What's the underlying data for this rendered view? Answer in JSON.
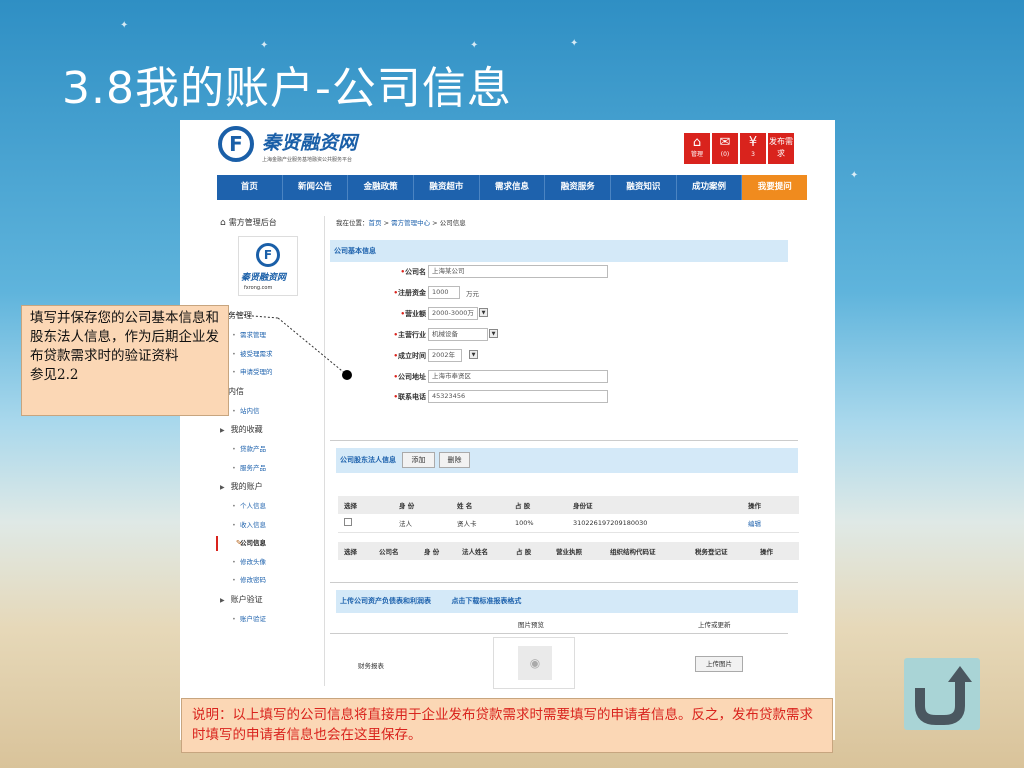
{
  "slide": {
    "title": "3.8我的账户-公司信息"
  },
  "site": {
    "logo_letter": "F",
    "logo_name": "秦贤融资网",
    "logo_tagline": "上海金融产业服务基地融资公共服务平台",
    "top_buttons": [
      {
        "icon": "home-icon",
        "label": "管理",
        "sub": ""
      },
      {
        "icon": "mail-icon",
        "label": "(0)",
        "sub": ""
      },
      {
        "icon": "yen-icon",
        "label": "3",
        "sub": ""
      }
    ],
    "publish_button": "发布需求",
    "nav": [
      "首页",
      "新闻公告",
      "金融政策",
      "融资超市",
      "需求信息",
      "融资服务",
      "融资知识",
      "成功案例",
      "我要提问"
    ]
  },
  "sidebar": {
    "heading": "需方管理后台",
    "logo_letter": "F",
    "logo_name": "秦贤融资网",
    "logo_url": "fxrong.com",
    "sections": [
      {
        "title": "业务管理",
        "items": [
          "需求管理",
          "被受理需求",
          "申请受理的"
        ]
      },
      {
        "title": "站内信",
        "items": [
          "站内信"
        ]
      },
      {
        "title": "我的收藏",
        "items": [
          "贷款产品",
          "服务产品"
        ]
      },
      {
        "title": "我的账户",
        "items": [
          "个人信息",
          "收入信息",
          "公司信息",
          "修改头像",
          "修改密码"
        ]
      },
      {
        "title": "账户验证",
        "items": [
          "账户验证"
        ]
      }
    ],
    "current_item": "公司信息"
  },
  "breadcrumb": {
    "prefix": "我在位置：",
    "home": "首页",
    "sep1": " > ",
    "center": "需方管理中心",
    "sep2": " > ",
    "current": "公司信息"
  },
  "company_form": {
    "section_title": "公司基本信息",
    "fields": [
      {
        "label": "公司名",
        "value": ""
      },
      {
        "label": "注册资金",
        "value": "1000",
        "suffix": "万元"
      },
      {
        "label": "营业额",
        "value": "2000-3000万"
      },
      {
        "label": "主营行业",
        "value": "机械设备"
      },
      {
        "label": "成立时间",
        "value": "2002年"
      },
      {
        "label": "公司地址",
        "value": "上海市奉贤区"
      },
      {
        "label": "联系电话",
        "value": "45323456"
      }
    ],
    "company_name_value": "上海某公司"
  },
  "shareholder": {
    "section_title": "公司股东法人信息",
    "add_button": "添加",
    "delete_button": "删除",
    "person_headers": [
      "选择",
      "身 份",
      "姓 名",
      "占 股",
      "身份证",
      "操作"
    ],
    "person_rows": [
      {
        "identity": "法人",
        "name": "贤人卡",
        "share": "100%",
        "id_card": "310226197209180030",
        "action": "编辑"
      }
    ],
    "company_headers": [
      "选择",
      "公司名",
      "身 份",
      "法人姓名",
      "占 股",
      "营业执照",
      "组织结构代码证",
      "税务登记证",
      "操作"
    ]
  },
  "upload": {
    "section_title": "上传公司资产负债表和利润表",
    "download_link": "点击下载标准报表格式",
    "col_preview": "图片预览",
    "col_action": "上传或更新",
    "row_label": "财务报表",
    "upload_button": "上传图片"
  },
  "callouts": {
    "left_text": "填写并保存您的公司基本信息和股东法人信息，作为后期企业发布贷款需求时的验证资料",
    "left_ref": "参见2.2",
    "bottom_text": "说明：以上填写的公司信息将直接用于企业发布贷款需求时需要填写的申请者信息。反之，发布贷款需求时填写的申请者信息也会在这里保存。"
  }
}
